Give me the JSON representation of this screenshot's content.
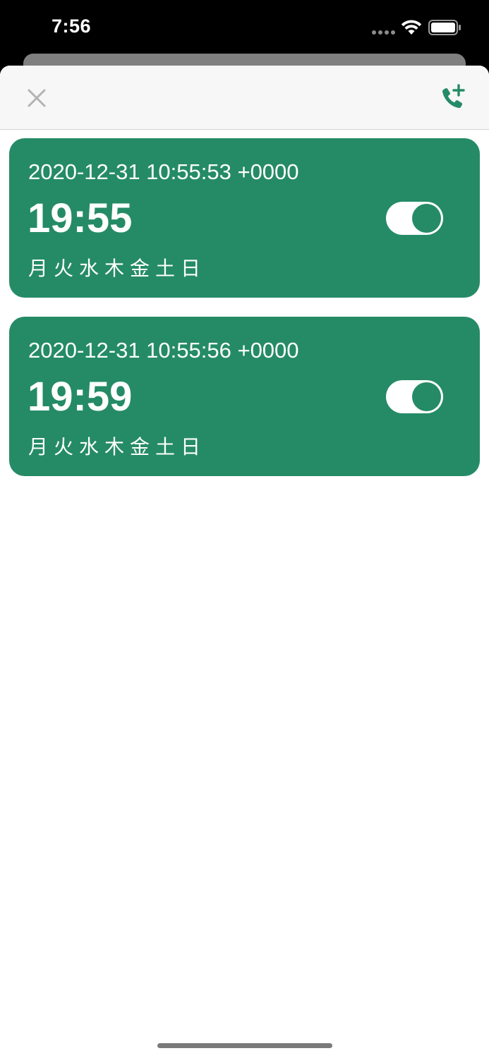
{
  "status_bar": {
    "time": "7:56"
  },
  "nav": {
    "close_icon": "close-icon",
    "add_icon": "phone-add-icon"
  },
  "colors": {
    "accent": "#258b67",
    "nav_background": "#f7f7f7",
    "close_icon": "#b3b3b3"
  },
  "alarms": [
    {
      "date": "2020-12-31 10:55:53 +0000",
      "time": "19:55",
      "days": "月火水木金土日",
      "enabled": true
    },
    {
      "date": "2020-12-31 10:55:56 +0000",
      "time": "19:59",
      "days": "月火水木金土日",
      "enabled": true
    }
  ]
}
